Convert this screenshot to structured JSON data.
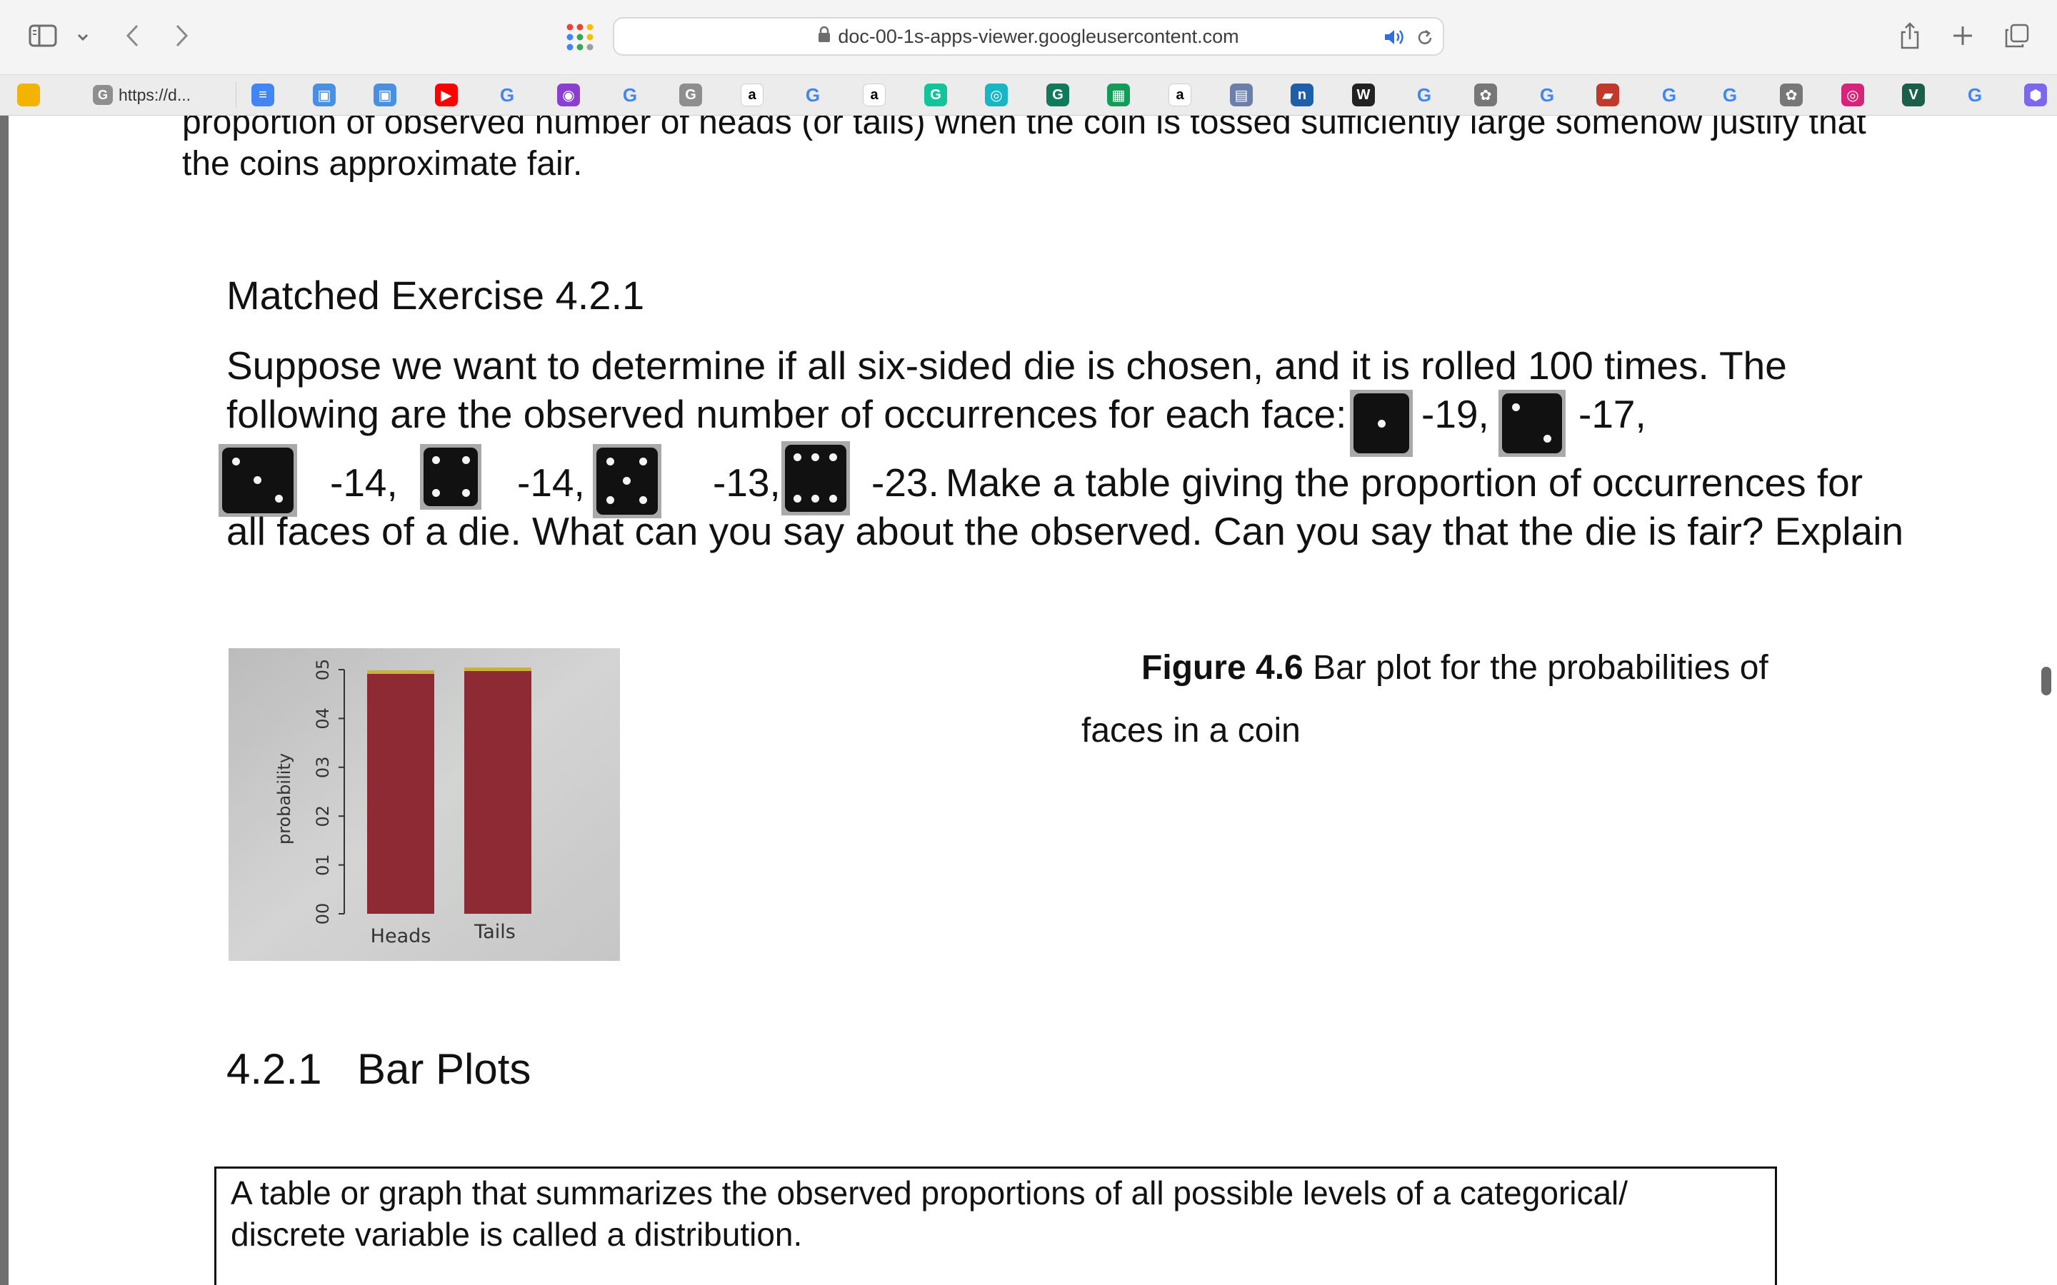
{
  "browser": {
    "url": "doc-00-1s-apps-viewer.googleusercontent.com",
    "tab_label": "https://d...",
    "bookmarks": [
      {
        "icon": "classroom-icon",
        "glyph": "",
        "color": "#f2b400"
      },
      {
        "icon": "docs-icon",
        "glyph": "≡",
        "color": "#4285f4"
      },
      {
        "icon": "calendar-icon",
        "glyph": "▣",
        "color": "#4a90e2"
      },
      {
        "icon": "calendar-icon",
        "glyph": "▣",
        "color": "#4a90e2"
      },
      {
        "icon": "youtube-icon",
        "glyph": "▶",
        "color": "#ff0000"
      },
      {
        "icon": "google-icon",
        "glyph": "G",
        "color": "#4285f4"
      },
      {
        "icon": "podcast-icon",
        "glyph": "◉",
        "color": "#8a3fd1"
      },
      {
        "icon": "google-icon",
        "glyph": "G",
        "color": "#4285f4"
      },
      {
        "icon": "google-gray-icon",
        "glyph": "G",
        "color": "#8e8e8e"
      },
      {
        "icon": "amazon-icon",
        "glyph": "a",
        "color": "#ffffff"
      },
      {
        "icon": "google-icon",
        "glyph": "G",
        "color": "#4285f4"
      },
      {
        "icon": "amazon-icon",
        "glyph": "a",
        "color": "#ffffff"
      },
      {
        "icon": "grammarly-icon",
        "glyph": "G",
        "color": "#15c39a"
      },
      {
        "icon": "brain-icon",
        "glyph": "◎",
        "color": "#18b6c4"
      },
      {
        "icon": "grammarly-icon",
        "glyph": "G",
        "color": "#0f7a5c"
      },
      {
        "icon": "sheets-icon",
        "glyph": "▦",
        "color": "#0f9d58"
      },
      {
        "icon": "amazon-icon",
        "glyph": "a",
        "color": "#ffffff"
      },
      {
        "icon": "map-icon",
        "glyph": "▤",
        "color": "#6c7fa8"
      },
      {
        "icon": "n-icon",
        "glyph": "n",
        "color": "#1d5fa8"
      },
      {
        "icon": "w-icon",
        "glyph": "W",
        "color": "#222222"
      },
      {
        "icon": "google-icon",
        "glyph": "G",
        "color": "#4285f4"
      },
      {
        "icon": "openai-icon",
        "glyph": "✿",
        "color": "#777777"
      },
      {
        "icon": "google-icon",
        "glyph": "G",
        "color": "#4285f4"
      },
      {
        "icon": "book-icon",
        "glyph": "▰",
        "color": "#c0392b"
      },
      {
        "icon": "google-icon",
        "glyph": "G",
        "color": "#4285f4"
      },
      {
        "icon": "google-icon",
        "glyph": "G",
        "color": "#4285f4"
      },
      {
        "icon": "openai-icon",
        "glyph": "✿",
        "color": "#777777"
      },
      {
        "icon": "instagram-icon",
        "glyph": "◎",
        "color": "#d6247a"
      },
      {
        "icon": "v-icon",
        "glyph": "V",
        "color": "#1b5e4a"
      },
      {
        "icon": "google-icon",
        "glyph": "G",
        "color": "#4285f4"
      },
      {
        "icon": "hexagon-icon",
        "glyph": "⬢",
        "color": "#7b68ee"
      }
    ]
  },
  "document": {
    "top_para_line1": "proportion of observed number of heads (or tails) when the coin is tossed sufficiently large somehow justify that",
    "top_para_line2": "the coins approximate fair.",
    "exercise_title": "Matched Exercise 4.2.1",
    "ex_line1": "Suppose we want to determine if all six-sided die is chosen, and it is rolled 100 times. The",
    "ex_line2_start": "following are the observed number of occurrences for each face:",
    "counts": [
      "-19,",
      "-17,",
      "-14,",
      "-14,",
      "-13,",
      "-23."
    ],
    "ex_line3_end": "Make a table giving the proportion of occurrences for",
    "ex_line4": "all faces of a die. What can you say about the observed. Can you say that the die is fair? Explain",
    "caption_bold": "Figure 4.6",
    "caption_rest": "Bar plot for the probabilities of",
    "caption_line2": "faces in a coin",
    "section_number": "4.2.1",
    "section_title": "Bar Plots",
    "box_line1": "A table or graph that summarizes the observed proportions of all possible levels of a categorical/",
    "box_line2": "discrete variable is called a distribution."
  },
  "chart_data": {
    "type": "bar",
    "categories": [
      "Heads",
      "Tails"
    ],
    "values": [
      0.5,
      0.5
    ],
    "ylabel": "probability",
    "ytick_labels": [
      "00",
      "01",
      "02",
      "03",
      "04",
      "05"
    ],
    "ylim": [
      0,
      0.5
    ],
    "bar_color": "#8e2a34"
  }
}
